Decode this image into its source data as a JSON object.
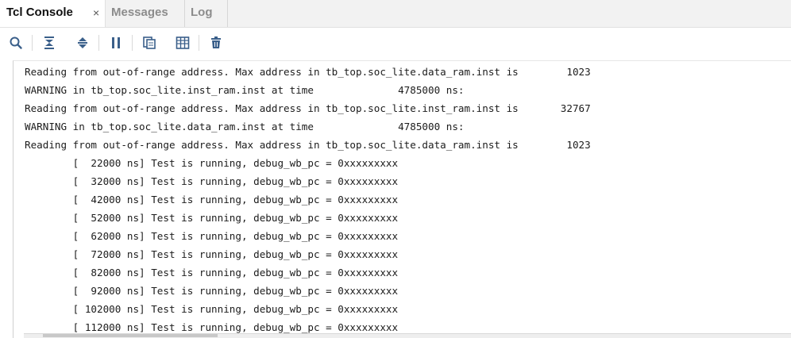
{
  "tabs": [
    {
      "label": "Tcl Console",
      "active": true
    },
    {
      "label": "Messages",
      "active": false
    },
    {
      "label": "Log",
      "active": false
    }
  ],
  "close_glyph": "×",
  "toolbar": [
    {
      "name": "search-icon"
    },
    {
      "name": "collapse-all-icon"
    },
    {
      "name": "expand-all-icon"
    },
    {
      "name": "pause-icon"
    },
    {
      "name": "copy-icon"
    },
    {
      "name": "columns-icon"
    },
    {
      "name": "trash-icon"
    }
  ],
  "console_lines": [
    "Reading from out-of-range address. Max address in tb_top.soc_lite.data_ram.inst is        1023",
    "WARNING in tb_top.soc_lite.inst_ram.inst at time              4785000 ns:",
    "Reading from out-of-range address. Max address in tb_top.soc_lite.inst_ram.inst is       32767",
    "WARNING in tb_top.soc_lite.data_ram.inst at time              4785000 ns:",
    "Reading from out-of-range address. Max address in tb_top.soc_lite.data_ram.inst is        1023",
    "        [  22000 ns] Test is running, debug_wb_pc = 0xxxxxxxxx",
    "        [  32000 ns] Test is running, debug_wb_pc = 0xxxxxxxxx",
    "        [  42000 ns] Test is running, debug_wb_pc = 0xxxxxxxxx",
    "        [  52000 ns] Test is running, debug_wb_pc = 0xxxxxxxxx",
    "        [  62000 ns] Test is running, debug_wb_pc = 0xxxxxxxxx",
    "        [  72000 ns] Test is running, debug_wb_pc = 0xxxxxxxxx",
    "        [  82000 ns] Test is running, debug_wb_pc = 0xxxxxxxxx",
    "        [  92000 ns] Test is running, debug_wb_pc = 0xxxxxxxxx",
    "        [ 102000 ns] Test is running, debug_wb_pc = 0xxxxxxxxx",
    "        [ 112000 ns] Test is running, debug_wb_pc = 0xxxxxxxxx"
  ],
  "colors": {
    "icon": "#3a5f8a",
    "icon_red": "#c0392b",
    "text": "#1c1c1c",
    "tab_inactive": "#8c8c8c"
  }
}
